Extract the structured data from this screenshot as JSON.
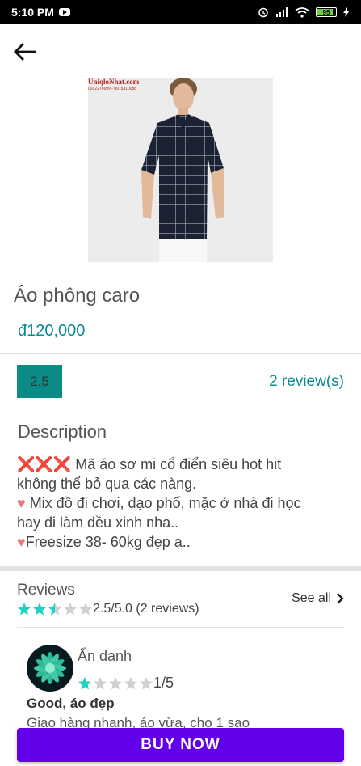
{
  "status_bar": {
    "time": "5:10 PM",
    "battery": "95"
  },
  "product": {
    "name": "Áo phông caro",
    "price": "đ120,000",
    "image_watermark_brand": "UniqloNhat.com",
    "image_watermark_phone": "0912276699 - 0915310088"
  },
  "rating": {
    "value": "2.5",
    "review_count_label": "2 review(s)"
  },
  "description": {
    "title": "Description",
    "line1_icons": "❌❌❌",
    "line1_text": " Mã áo sơ mi cổ điển siêu hot hit",
    "line2": "không thể bỏ qua các nàng.",
    "line3_icon": "♥",
    "line3_text": " Mix đồ đi chơi, dạo phố, mặc ở nhà đi học",
    "line4": "hay đi làm đều xinh nha..",
    "line5_icon": "♥",
    "line5_text": "Freesize 38- 60kg đẹp ạ.."
  },
  "reviews": {
    "title": "Reviews",
    "summary": "2.5/5.0 (2 reviews)",
    "average_stars": 2.5,
    "see_all_label": "See all",
    "items": [
      {
        "author": "Ẩn danh",
        "stars": 1,
        "score_label": "1/5",
        "headline": "Good, áo đẹp",
        "body": "Giao hàng nhanh, áo vừa, cho 1 sao"
      }
    ]
  },
  "actions": {
    "buy_now_label": "BUY NOW"
  },
  "colors": {
    "accent_teal": "#0a8a8f",
    "star_filled": "#1fd1c1",
    "star_empty": "#d0d0d0",
    "buy_button": "#6200ea"
  }
}
